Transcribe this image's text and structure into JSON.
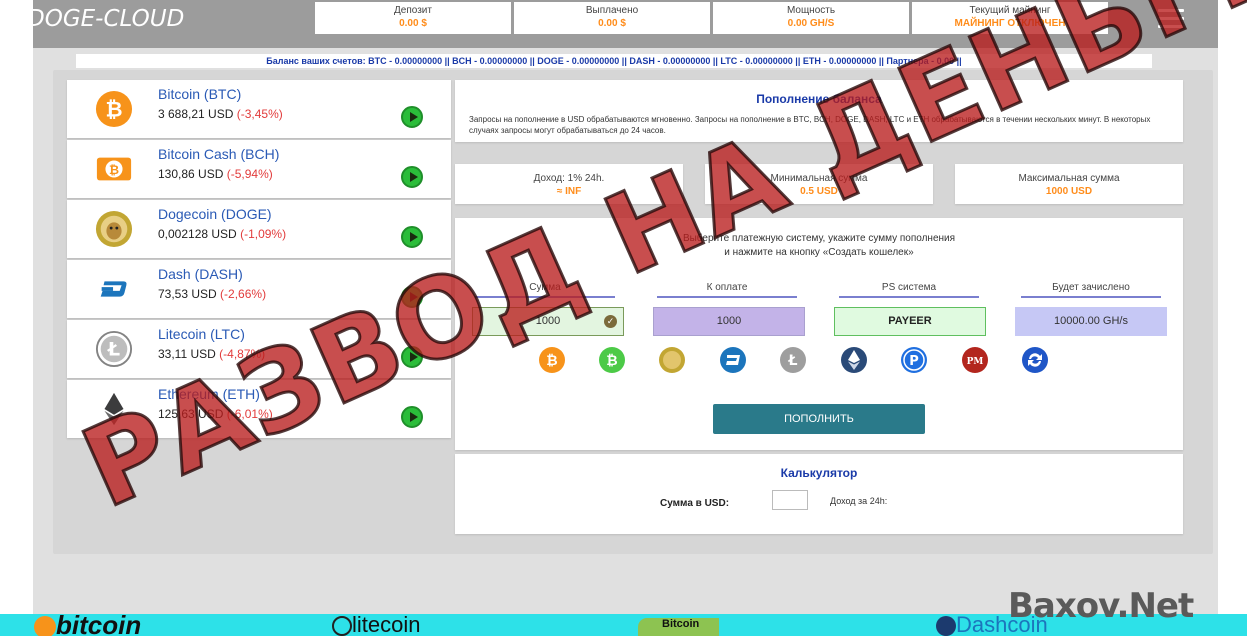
{
  "header": {
    "logo": "DOGE-CLOUD",
    "stats": [
      {
        "label": "Депозит",
        "value": "0.00 $"
      },
      {
        "label": "Выплачено",
        "value": "0.00 $"
      },
      {
        "label": "Мощность",
        "value": "0.00 GH/S"
      },
      {
        "label": "Текущий майнинг",
        "value": "МАЙНИНГ ОТКЛЮЧЕН"
      }
    ],
    "menu_icon": "hamburger-icon"
  },
  "balance_text": "Баланс ваших счетов: BTC - 0.00000000 || BCH - 0.00000000 || DOGE - 0.00000000 || DASH - 0.00000000 || LTC - 0.00000000 || ETH - 0.00000000 || Партнера - 0.00 ||",
  "coins": [
    {
      "name": "Bitcoin (BTC)",
      "price": "3 688,21 USD",
      "change": "(-3,45%)",
      "color": "#f7931a"
    },
    {
      "name": "Bitcoin Cash (BCH)",
      "price": "130,86 USD",
      "change": "(-5,94%)",
      "color": "#f7931a"
    },
    {
      "name": "Dogecoin (DOGE)",
      "price": "0,002128 USD",
      "change": "(-1,09%)",
      "color": "#c2a633"
    },
    {
      "name": "Dash (DASH)",
      "price": "73,53 USD",
      "change": "(-2,66%)",
      "color": "#1c75bc"
    },
    {
      "name": "Litecoin (LTC)",
      "price": "33,11 USD",
      "change": "(-4,87%)",
      "color": "#838383"
    },
    {
      "name": "Ethereum (ETH)",
      "price": "125,63 USD",
      "change": "(-6,01%)",
      "color": "#3c3c3d"
    }
  ],
  "deposit": {
    "title": "Пополнение баланса",
    "text": "Запросы на пополнение в USD обрабатываются мгновенно. Запросы на пополнение в BTC, BCH, DOGE, DASH, LTC и ETH обрабатываются в течении нескольких минут. В некоторых случаях запросы могут обрабатываться до 24 часов."
  },
  "info": [
    {
      "label": "Доход: 1% 24h.",
      "value": "≈ INF"
    },
    {
      "label": "Минимальная сумма",
      "value": "0.5 USD"
    },
    {
      "label": "Максимальная сумма",
      "value": "1000 USD"
    }
  ],
  "form": {
    "text_line1": "Выберите платежную систему, укажите сумму пополнения",
    "text_line2": "и нажмите на кнопку «Создать кошелек»",
    "headers": [
      "Сумма",
      "К оплате",
      "PS система",
      "Будет зачислено"
    ],
    "amount_value": "1000",
    "pay_value": "1000",
    "ps_value": "PAYEER",
    "credit_value": "10000.00 GH/s",
    "submit_label": "ПОПОЛНИТЬ",
    "payment_icons": [
      "bitcoin-icon",
      "bitcoin-cash-icon",
      "dogecoin-icon",
      "dash-icon",
      "litecoin-icon",
      "ethereum-icon",
      "payeer-icon",
      "perfect-money-icon",
      "exchange-icon"
    ]
  },
  "calculator": {
    "title": "Калькулятор",
    "label": "Сумма в USD:",
    "income_label": "Доход за 24h:"
  },
  "banner": {
    "bitcoin": "bitcoin",
    "litecoin": "litecoin",
    "bitcoin_cash": "Bitcoin",
    "dash": "Dashcoin"
  },
  "watermark": "РАЗВОД НА ДЕНЬГИ",
  "site_mark": "Baxov.Net"
}
